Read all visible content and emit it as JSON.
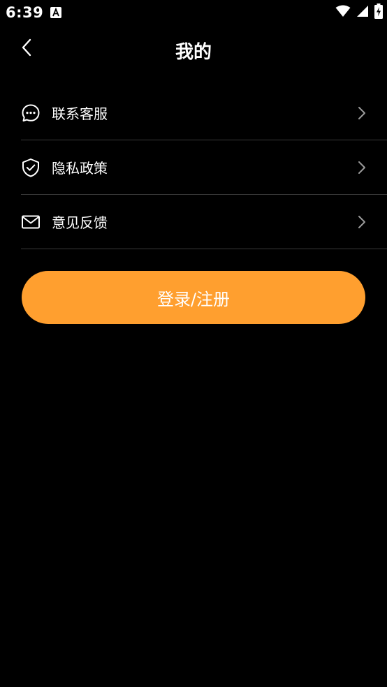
{
  "status_bar": {
    "time": "6:39",
    "icons": [
      "notification-a-icon",
      "wifi-icon",
      "signal-icon",
      "battery-charging-icon"
    ]
  },
  "header": {
    "title": "我的",
    "back_icon": "chevron-left-icon"
  },
  "menu": {
    "items": [
      {
        "label": "联系客服",
        "icon": "chat-bubble-icon"
      },
      {
        "label": "隐私政策",
        "icon": "shield-check-icon"
      },
      {
        "label": "意见反馈",
        "icon": "envelope-icon"
      }
    ],
    "chevron_icon": "chevron-right-icon"
  },
  "login": {
    "label": "登录/注册"
  },
  "colors": {
    "background": "#000000",
    "accent": "#ff9f2f",
    "text": "#ffffff",
    "divider": "#3a3a3a"
  }
}
